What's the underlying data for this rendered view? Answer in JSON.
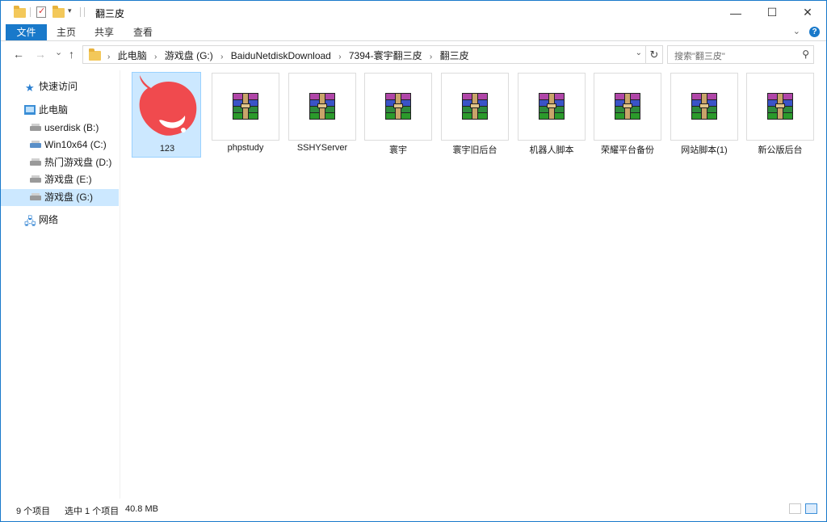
{
  "window": {
    "title": "翻三皮",
    "controls": {
      "minimize": "—",
      "maximize": "☐",
      "close": "✕"
    }
  },
  "ribbon": {
    "file_tab": "文件",
    "tabs": [
      "主页",
      "共享",
      "查看"
    ],
    "help": "?"
  },
  "navigation": {
    "back": "←",
    "forward": "→",
    "recent": "⌄",
    "up": "↑",
    "breadcrumbs": [
      "此电脑",
      "游戏盘 (G:)",
      "BaiduNetdiskDownload",
      "7394-寰宇翻三皮",
      "翻三皮"
    ],
    "refresh": "↻",
    "search_placeholder": "搜索\"翻三皮\""
  },
  "sidebar": {
    "quick_access": "快速访问",
    "this_pc": "此电脑",
    "drives": [
      "userdisk (B:)",
      "Win10x64 (C:)",
      "热门游戏盘 (D:)",
      "游戏盘 (E:)",
      "游戏盘 (G:)"
    ],
    "selected_drive": "游戏盘 (G:)",
    "network": "网络"
  },
  "files": [
    {
      "name": "123",
      "kind": "image",
      "selected": true
    },
    {
      "name": "phpstudy",
      "kind": "rar"
    },
    {
      "name": "SSHYServer",
      "kind": "rar"
    },
    {
      "name": "寰宇",
      "kind": "rar"
    },
    {
      "name": "寰宇旧后台",
      "kind": "rar"
    },
    {
      "name": "机器人脚本",
      "kind": "rar"
    },
    {
      "name": "荣耀平台备份",
      "kind": "rar"
    },
    {
      "name": "网站脚本(1)",
      "kind": "rar"
    },
    {
      "name": "新公版后台",
      "kind": "rar"
    }
  ],
  "status": {
    "item_count": "9 个项目",
    "selection": "选中 1 个项目",
    "size": "40.8 MB"
  },
  "colors": {
    "accent": "#1979ca",
    "selection": "#cce8ff",
    "image_icon": "#f04a4e"
  }
}
